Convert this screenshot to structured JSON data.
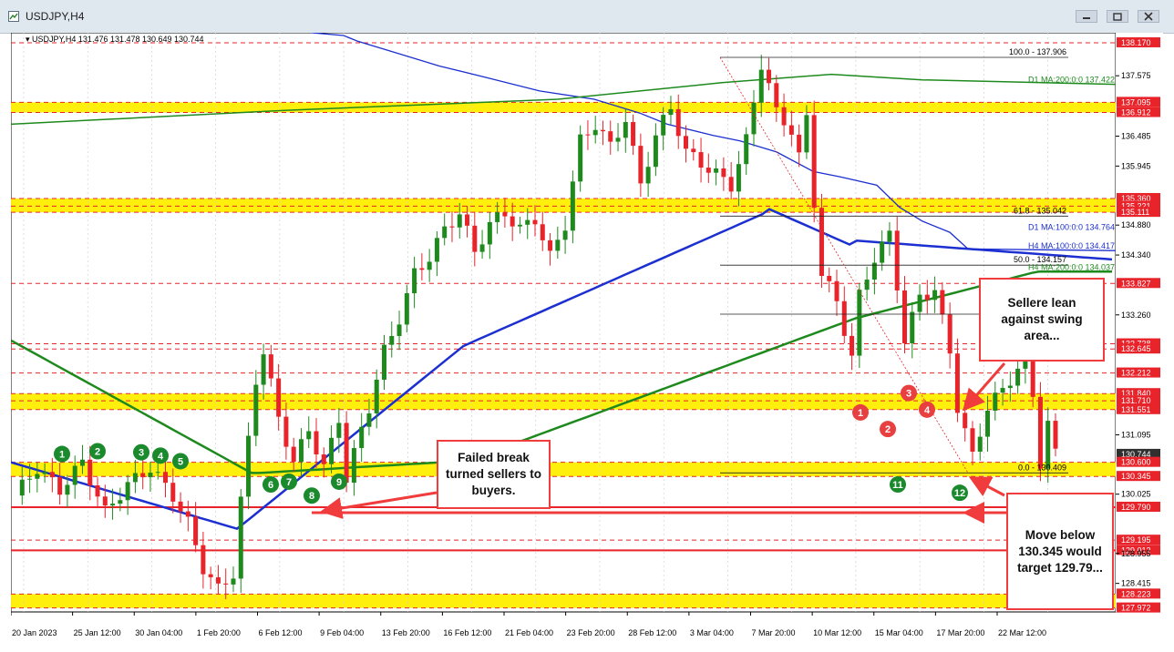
{
  "window": {
    "title": "USDJPY,H4",
    "buttons": [
      "minimize",
      "restore",
      "close"
    ]
  },
  "chart_header": {
    "symbol": "USDJPY,H4",
    "ohlc": "131.476 131.478 130.649 130.744"
  },
  "chart_data": {
    "type": "candlestick",
    "instrument": "USDJPY",
    "timeframe": "H4",
    "y_range": [
      127.9,
      138.35
    ],
    "price_ticks": [
      "138.170",
      "137.575",
      "137.095",
      "136.912",
      "136.485",
      "135.945",
      "135.360",
      "135.221",
      "135.111",
      "134.880",
      "134.340",
      "133.827",
      "133.260",
      "132.738",
      "132.645",
      "132.212",
      "131.840",
      "131.710",
      "131.551",
      "131.095",
      "130.744",
      "130.600",
      "130.345",
      "130.025",
      "129.790",
      "129.195",
      "129.012",
      "128.955",
      "128.415",
      "128.223",
      "127.972"
    ],
    "price_tag_colors": {
      "red": "#e8232a",
      "dark": "#303030"
    },
    "dates": [
      "20 Jan 2023",
      "25 Jan 12:00",
      "30 Jan 04:00",
      "1 Feb 20:00",
      "6 Feb 12:00",
      "9 Feb 04:00",
      "13 Feb 20:00",
      "16 Feb 12:00",
      "21 Feb 04:00",
      "23 Feb 20:00",
      "28 Feb 12:00",
      "3 Mar 04:00",
      "7 Mar 20:00",
      "10 Mar 12:00",
      "15 Mar 04:00",
      "17 Mar 20:00",
      "22 Mar 12:00"
    ],
    "price_path": [
      [
        0,
        130.0
      ],
      [
        3,
        130.5
      ],
      [
        6,
        130.1
      ],
      [
        9,
        130.6
      ],
      [
        12,
        129.7
      ],
      [
        15,
        130.2
      ],
      [
        18,
        130.5
      ],
      [
        21,
        130.0
      ],
      [
        23,
        129.5
      ],
      [
        25,
        128.7
      ],
      [
        27,
        128.3
      ],
      [
        29,
        128.6
      ],
      [
        30,
        129.9
      ],
      [
        32,
        132.1
      ],
      [
        33,
        132.6
      ],
      [
        35,
        131.4
      ],
      [
        37,
        130.6
      ],
      [
        39,
        131.2
      ],
      [
        41,
        130.5
      ],
      [
        43,
        131.4
      ],
      [
        44,
        130.3
      ],
      [
        46,
        131.2
      ],
      [
        47,
        131.6
      ],
      [
        49,
        132.6
      ],
      [
        51,
        133.2
      ],
      [
        53,
        134.0
      ],
      [
        55,
        134.3
      ],
      [
        57,
        134.8
      ],
      [
        59,
        135.1
      ],
      [
        61,
        134.4
      ],
      [
        63,
        134.9
      ],
      [
        65,
        135.1
      ],
      [
        67,
        134.8
      ],
      [
        69,
        135.0
      ],
      [
        71,
        134.3
      ],
      [
        73,
        134.9
      ],
      [
        75,
        136.4
      ],
      [
        77,
        136.7
      ],
      [
        79,
        136.3
      ],
      [
        81,
        136.8
      ],
      [
        83,
        135.6
      ],
      [
        85,
        136.5
      ],
      [
        87,
        137.0
      ],
      [
        89,
        136.2
      ],
      [
        91,
        136.0
      ],
      [
        93,
        135.8
      ],
      [
        95,
        135.6
      ],
      [
        97,
        136.4
      ],
      [
        98,
        137.1
      ],
      [
        99,
        137.8
      ],
      [
        100,
        137.4
      ],
      [
        101,
        136.9
      ],
      [
        103,
        136.6
      ],
      [
        104,
        136.1
      ],
      [
        105,
        136.8
      ],
      [
        106,
        135.3
      ],
      [
        107,
        134.0
      ],
      [
        109,
        133.5
      ],
      [
        111,
        132.5
      ],
      [
        112,
        133.6
      ],
      [
        114,
        134.3
      ],
      [
        116,
        134.7
      ],
      [
        117,
        133.8
      ],
      [
        118,
        132.8
      ],
      [
        120,
        133.6
      ],
      [
        122,
        133.7
      ],
      [
        124,
        132.6
      ],
      [
        125,
        131.6
      ],
      [
        127,
        130.7
      ],
      [
        129,
        131.6
      ],
      [
        131,
        131.9
      ],
      [
        133,
        132.3
      ],
      [
        134,
        132.8
      ],
      [
        135,
        131.8
      ],
      [
        136,
        130.6
      ],
      [
        137,
        131.3
      ],
      [
        138,
        130.744
      ]
    ],
    "series": [
      {
        "name": "H4 MA:100:0:0",
        "value": "134.417",
        "color": "#1c2fd0"
      },
      {
        "name": "H4 MA:200:0:0",
        "value": "134.037",
        "color": "#1e8a1e"
      },
      {
        "name": "D1 MA:100:0:0",
        "value": "134.764",
        "color": "#1c2fd0"
      },
      {
        "name": "D1 MA:200:0:0",
        "value": "137.422",
        "color": "#1e8a1e"
      }
    ],
    "fib_levels": [
      {
        "label": "100.0 - 137.906",
        "price": 137.906
      },
      {
        "label": "61.8 - 135.042",
        "price": 135.042
      },
      {
        "label": "50.0 - 134.157",
        "price": 134.157
      },
      {
        "label": ".273",
        "price": 133.273
      },
      {
        "label": "0.0 - 130.409",
        "price": 130.409
      }
    ],
    "support_zones": [
      {
        "low": 136.912,
        "high": 137.095
      },
      {
        "low": 135.111,
        "high": 135.36
      },
      {
        "low": 131.551,
        "high": 131.84
      },
      {
        "low": 130.345,
        "high": 130.6
      },
      {
        "low": 127.972,
        "high": 128.223
      }
    ],
    "red_levels": [
      138.17,
      137.095,
      136.912,
      135.36,
      135.221,
      135.111,
      133.827,
      132.738,
      132.645,
      132.212,
      131.84,
      131.71,
      131.551,
      130.6,
      130.345,
      129.79,
      129.195,
      129.012,
      128.223,
      127.972
    ],
    "green_markers": [
      "1",
      "2",
      "3",
      "4",
      "5",
      "6",
      "7",
      "8",
      "9",
      "11",
      "12"
    ],
    "red_markers": [
      "1",
      "2",
      "3",
      "4"
    ]
  },
  "annotations": {
    "failed_break": "Failed break turned sellers to buyers.",
    "sellers_lean": "Sellere lean against swing area...",
    "move_below": "Move below 130.345 would target 129.79..."
  },
  "colors": {
    "up_candle": "#1e8a1e",
    "down_candle": "#e8232a",
    "zone": "#ffee00",
    "level_line": "#e8232a",
    "marker_green": "#1a8a2c",
    "marker_red": "#e84040"
  }
}
